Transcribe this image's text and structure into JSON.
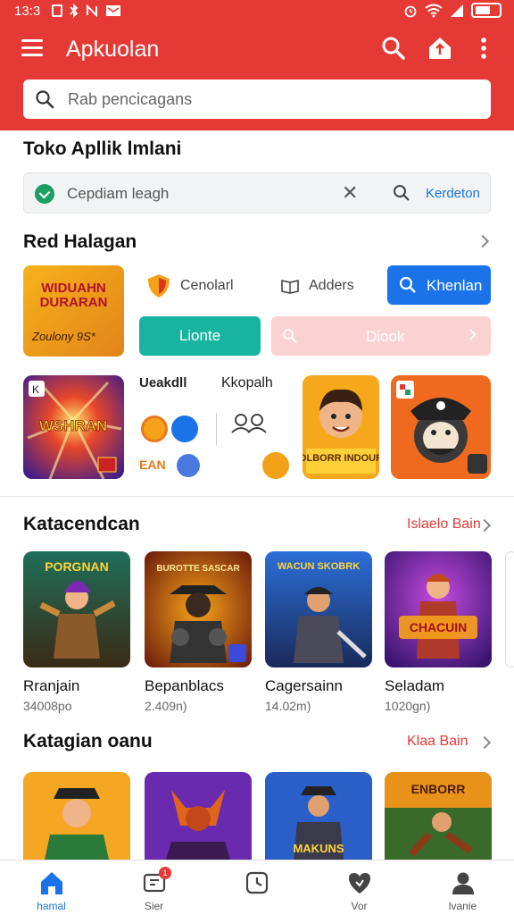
{
  "status": {
    "time": "13:3"
  },
  "appbar": {
    "title": "Apkuolan"
  },
  "search": {
    "placeholder": "Rab pencicagans"
  },
  "store": {
    "title": "Toko Apllik lmlani",
    "filter_text": "Cepdiam leagh",
    "filter_link": "Kerdeton"
  },
  "recommended": {
    "title": "Red Halagan",
    "promo_line1": "WIDUAHN DURARAN",
    "promo_line2": "Zoulony 9S*",
    "chip1": "Cenolarl",
    "chip2": "Adders",
    "blue_button": "Khenlan",
    "teal_button": "Lionte",
    "pink_button": "Diook",
    "mid1_title": "Ueakdll",
    "mid1_label": "EAN",
    "mid2_title": "Kkopalh",
    "tile_text_hero": "WSHRAN",
    "tile_text_boy": "SOLBORR INDOURE"
  },
  "featured": {
    "title": "Katacendcan",
    "link": "Islaelo Bain",
    "apps": [
      {
        "name": "Rranjain",
        "size": "34008po",
        "art_text": "PORGNAN"
      },
      {
        "name": "Bepanblacs",
        "size": "2.409n)",
        "art_text": "BUROTTE SASCAR"
      },
      {
        "name": "Cagersainn",
        "size": "14.02m)",
        "art_text": "WACUN SKOBRK"
      },
      {
        "name": "Seladam",
        "size": "1020gn)",
        "art_text": "CHACUIN"
      }
    ]
  },
  "category": {
    "title": "Katagian oanu",
    "link": "Klaa Bain",
    "art_texts": [
      "",
      "",
      "MAKUNS",
      "ENBORR"
    ]
  },
  "nav": [
    {
      "label": "hamal",
      "icon": "home-icon"
    },
    {
      "label": "Sier",
      "icon": "store-icon",
      "badge": "1"
    },
    {
      "label": "",
      "icon": "clock-icon"
    },
    {
      "label": "Vor",
      "icon": "heart-icon"
    },
    {
      "label": "lvanie",
      "icon": "user-icon"
    }
  ],
  "colors": {
    "header": "#e53935",
    "accent_blue": "#1a73e8",
    "teal": "#17b4a0",
    "pink": "#fbd2d2",
    "nav_active": "#1a73e8"
  }
}
